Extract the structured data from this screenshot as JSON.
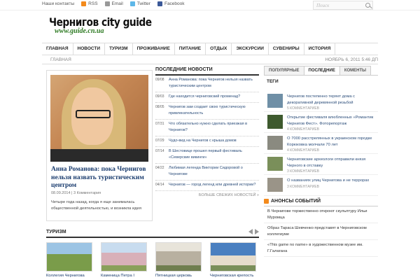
{
  "toplinks": [
    {
      "label": "Наши контакты",
      "icon": "contacts-icon",
      "color": ""
    },
    {
      "label": "RSS",
      "icon": "rss-icon",
      "color": "#f38a1c"
    },
    {
      "label": "Email",
      "icon": "email-icon",
      "color": "#999999"
    },
    {
      "label": "Twitter",
      "icon": "twitter-icon",
      "color": "#5eb7e8"
    },
    {
      "label": "Facebook",
      "icon": "facebook-icon",
      "color": "#3b5998"
    }
  ],
  "search": {
    "placeholder": "Поиск"
  },
  "logo": {
    "title": "Чернигов city guide",
    "url": "www.guide.cn.ua"
  },
  "nav": [
    "ГЛАВНАЯ",
    "НОВОСТИ",
    "ТУРИЗМ",
    "ПРОЖИВАНИЕ",
    "ПИТАНИЕ",
    "ОТДЫХ",
    "ЭКСКУРСИИ",
    "СУВЕНИРЫ",
    "ИСТОРИЯ"
  ],
  "breadcrumb": "ГЛАВНАЯ",
  "date": "НОЯБРЬ 6, 2011 5:46 ДП",
  "featured": {
    "title": "Анна Романова: пока Чернигов нельзя назвать туристическим центром",
    "date": "08.09.2014",
    "comments": "3 Комментария",
    "excerpt": "Четыре года назад, когда я еще занималась общественной деятельностью, и возникла идея"
  },
  "news": {
    "title": "ПОСЛЕДНИЕ НОВОСТИ",
    "more": "БОЛЬШЕ СВЕЖИХ НОВОСТЕЙ »",
    "items": [
      {
        "date": "09/08",
        "text": "Анна Романова: пока Чернигов нельзя назвать туристическим центром"
      },
      {
        "date": "09/03",
        "text": "Где находится черниговский променад?"
      },
      {
        "date": "08/05",
        "text": "Чернигов зам создает свою туристическую привлекательность"
      },
      {
        "date": "07/31",
        "text": "Что обязательно нужно сделать приезжая в Чернигов?"
      },
      {
        "date": "07/29",
        "text": "Чудо-вид на Чернигов с крыша домов"
      },
      {
        "date": "07/14",
        "text": "В Шестовице прошел первый фестиваль «Северские викинги»"
      },
      {
        "date": "04/22",
        "text": "Любимая легенда Виктории Сидоровой о Чернигове"
      },
      {
        "date": "04/14",
        "text": "Чернигов — город легенд или древней истории?"
      }
    ]
  },
  "sidebar": {
    "tabs": [
      "ПОПУЛЯРНЫЕ",
      "ПОСЛЕДНИЕ",
      "КОМЕНТЫ"
    ],
    "tags": "ТЕГИ",
    "popular": [
      {
        "title": "Чернигов постепенно теряет дома с декоративной деревянной резьбой",
        "comments": "5 КОММЕНТАРИЕВ",
        "color": "#6f8fa6"
      },
      {
        "title": "Открытие фестиваля влюбленных «Романтик Чернигов Фест». Фоторепортаж",
        "comments": "4 КОММЕНТАРИЕВ",
        "color": "#3e5a2e"
      },
      {
        "title": "О 7000 расстрелянных в украинском городке Корюковка молчали 70 лет",
        "comments": "4 КОММЕНТАРИЕВ",
        "color": "#8a8a80"
      },
      {
        "title": "Черниговские археологи отправили князя Черного в отставку",
        "comments": "3 КОММЕНТАРИЕВ",
        "color": "#7a8f5a"
      },
      {
        "title": "О названиях улиц Чернигова и не террорах",
        "comments": "3 КОММЕНТАРИЕВ",
        "color": "#9a9488"
      }
    ],
    "events": {
      "title": "АНОНСЫ СОБЫТИЙ",
      "items": [
        "В Чернигове торжественно откроют скульптуру Ильи Муромца",
        "Образ Тараса Шевченко представят в Черниговском коллегиуме",
        "«This game no name» в художественном музее им. Г.Галагана"
      ]
    }
  },
  "tourism": {
    "title": "ТУРИЗМ",
    "items": [
      {
        "caption": "Коллегия Чернигова",
        "color": "#7a9c4a"
      },
      {
        "caption": "Каменица Петра I",
        "color": "#d8b0b8"
      },
      {
        "caption": "Пятницкая церковь",
        "color": "#b8b0a0"
      },
      {
        "caption": "Черниговская крепость",
        "color": "#4a7fc0"
      }
    ]
  }
}
